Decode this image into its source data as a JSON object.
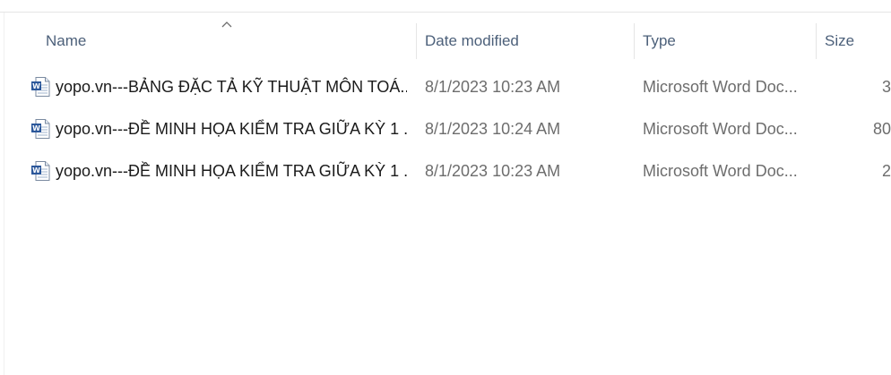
{
  "columns": {
    "name": "Name",
    "date_modified": "Date modified",
    "type": "Type",
    "size": "Size"
  },
  "sort": {
    "column": "name",
    "direction": "ascending",
    "icon": "chevron-up-icon"
  },
  "files": [
    {
      "icon": "word-document-icon",
      "name": "yopo.vn---BẢNG ĐẶC TẢ KỸ THUẬT MÔN TOÁ...",
      "date_modified": "8/1/2023 10:23 AM",
      "type": "Microsoft Word Doc...",
      "size": "3"
    },
    {
      "icon": "word-document-icon",
      "name": "yopo.vn---ĐỀ MINH HỌA KIỂM TRA GIỮA KỲ 1 ...",
      "date_modified": "8/1/2023 10:24 AM",
      "type": "Microsoft Word Doc...",
      "size": "80"
    },
    {
      "icon": "word-document-icon",
      "name": "yopo.vn---ĐỀ MINH HỌA KIỂM TRA GIỮA KỲ 1 ...",
      "date_modified": "8/1/2023 10:23 AM",
      "type": "Microsoft Word Doc...",
      "size": "2"
    }
  ]
}
